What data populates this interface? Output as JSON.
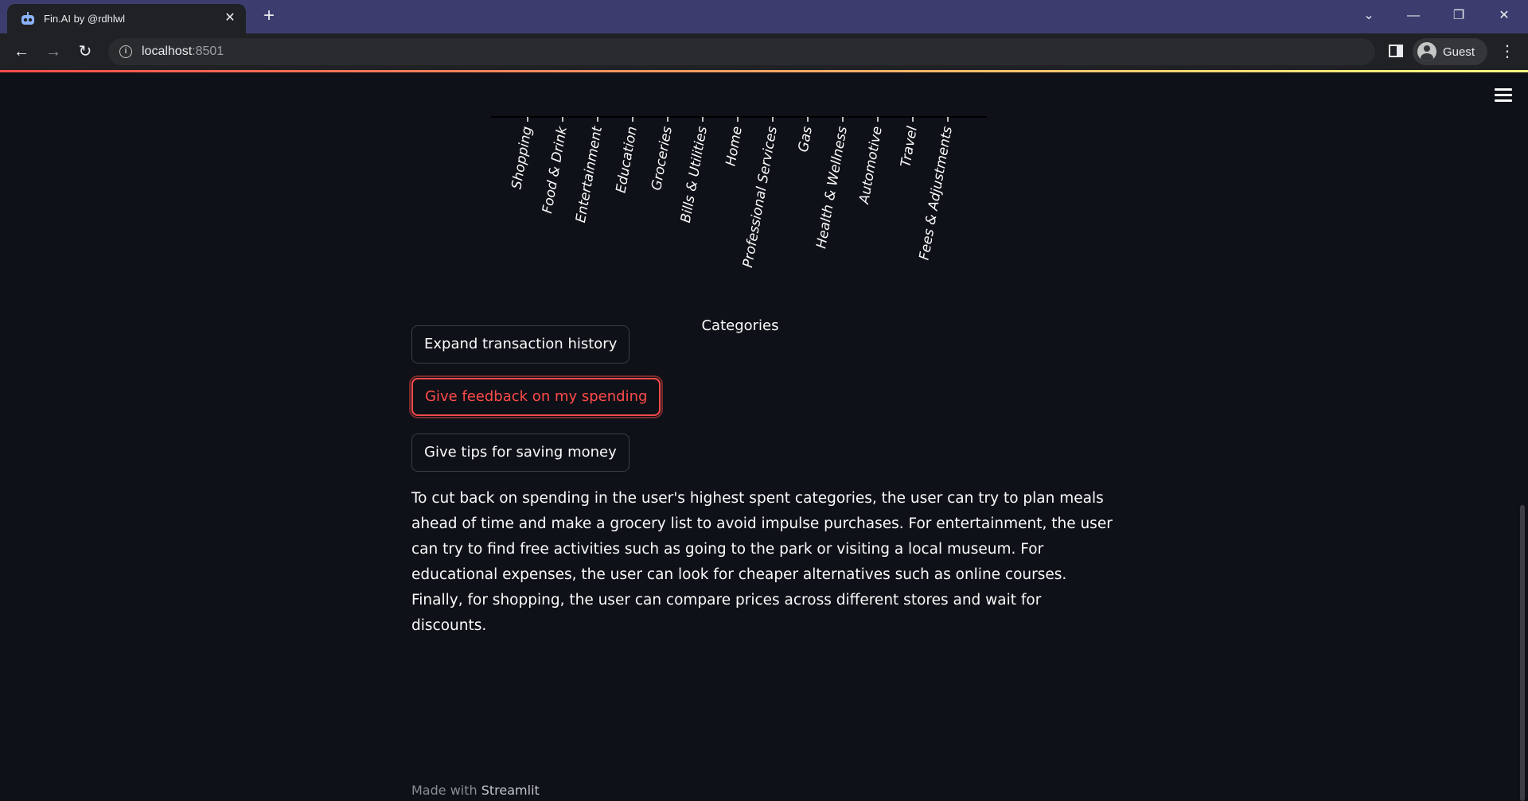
{
  "browser": {
    "tab_title": "Fin.AI by @rdhlwl",
    "url_host": "localhost",
    "url_port": ":8501",
    "profile_name": "Guest"
  },
  "chart_data": {
    "type": "bar",
    "xlabel": "Categories",
    "categories": [
      "Shopping",
      "Food & Drink",
      "Entertainment",
      "Education",
      "Groceries",
      "Bills & Utilities",
      "Home",
      "Professional Services",
      "Gas",
      "Health & Wellness",
      "Automotive",
      "Travel",
      "Fees & Adjustments"
    ],
    "tick_rotation": 80,
    "colors": {
      "axis": "#000000",
      "text": "#fafafa"
    }
  },
  "buttons": {
    "expand": "Expand transaction history",
    "feedback": "Give feedback on my spending",
    "tips": "Give tips for saving money"
  },
  "response_text": "To cut back on spending in the user's highest spent categories, the user can try to plan meals ahead of time and make a grocery list to avoid impulse purchases. For entertainment, the user can try to find free activities such as going to the park or visiting a local museum. For educational expenses, the user can look for cheaper alternatives such as online courses. Finally, for shopping, the user can compare prices across different stores and wait for discounts.",
  "footer": {
    "made_with": "Made with ",
    "link": "Streamlit"
  },
  "colors": {
    "background": "#0e1117",
    "accent": "#ff4b4b",
    "tabbar": "#3c3d6e"
  }
}
